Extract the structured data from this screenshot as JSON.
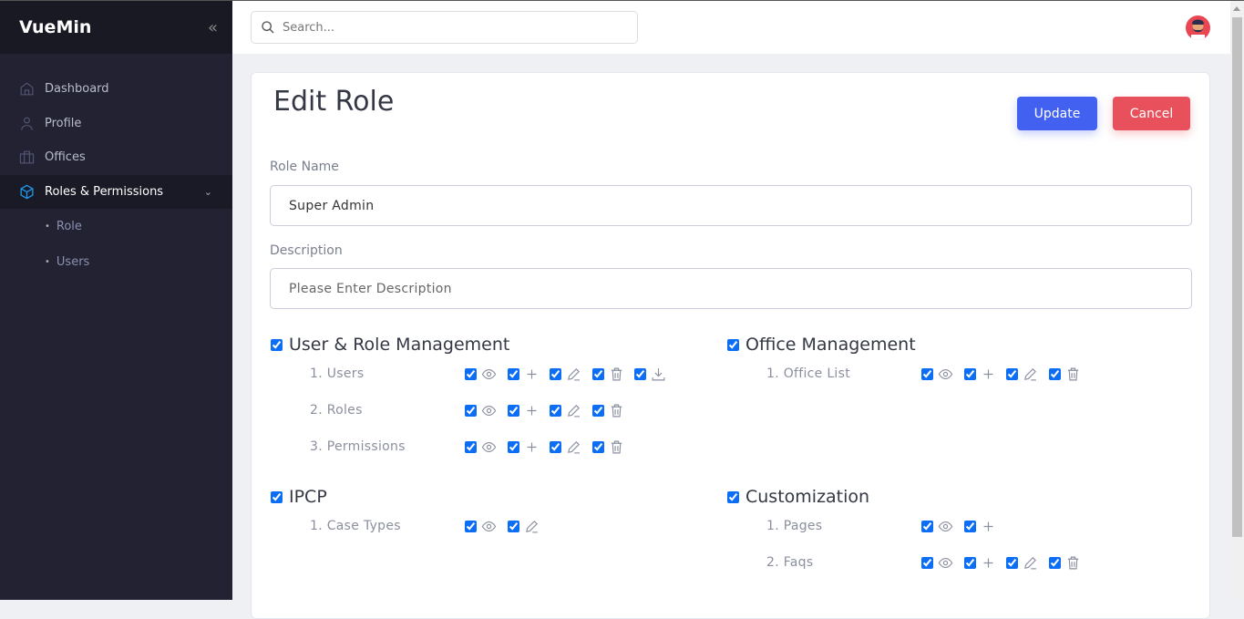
{
  "app": {
    "name": "VueMin"
  },
  "sidebar": {
    "items": [
      {
        "label": "Dashboard",
        "icon": "home-icon"
      },
      {
        "label": "Profile",
        "icon": "user-icon"
      },
      {
        "label": "Offices",
        "icon": "briefcase-icon"
      },
      {
        "label": "Roles & Permissions",
        "icon": "box-icon",
        "active": true
      }
    ],
    "subitems": [
      {
        "label": "Role"
      },
      {
        "label": "Users"
      }
    ]
  },
  "header": {
    "search_placeholder": "Search..."
  },
  "page": {
    "title": "Edit Role",
    "update_label": "Update",
    "cancel_label": "Cancel",
    "role_name_label": "Role Name",
    "role_name_value": "Super Admin",
    "description_label": "Description",
    "description_placeholder": "Please Enter Description"
  },
  "colors": {
    "primary": "#4261f0",
    "danger": "#e8515b",
    "accent": "#1e9bf0",
    "sidebar": "#222232"
  },
  "groups": [
    {
      "title": "User & Role Management",
      "checked": true,
      "items": [
        {
          "name": "1. Users",
          "perms": [
            {
              "icon": "eye",
              "checked": true
            },
            {
              "icon": "plus",
              "checked": true
            },
            {
              "icon": "pencil",
              "checked": true
            },
            {
              "icon": "trash",
              "checked": true
            },
            {
              "icon": "download",
              "checked": true
            }
          ]
        },
        {
          "name": "2. Roles",
          "perms": [
            {
              "icon": "eye",
              "checked": true
            },
            {
              "icon": "plus",
              "checked": true
            },
            {
              "icon": "pencil",
              "checked": true
            },
            {
              "icon": "trash",
              "checked": true
            }
          ]
        },
        {
          "name": "3. Permissions",
          "perms": [
            {
              "icon": "eye",
              "checked": true
            },
            {
              "icon": "plus",
              "checked": true
            },
            {
              "icon": "pencil",
              "checked": true
            },
            {
              "icon": "trash",
              "checked": true
            }
          ]
        }
      ]
    },
    {
      "title": "Office Management",
      "checked": true,
      "items": [
        {
          "name": "1. Office List",
          "perms": [
            {
              "icon": "eye",
              "checked": true
            },
            {
              "icon": "plus",
              "checked": true
            },
            {
              "icon": "pencil",
              "checked": true
            },
            {
              "icon": "trash",
              "checked": true
            }
          ]
        }
      ]
    },
    {
      "title": "IPCP",
      "checked": true,
      "items": [
        {
          "name": "1. Case Types",
          "perms": [
            {
              "icon": "eye",
              "checked": true
            },
            {
              "icon": "pencil",
              "checked": true
            }
          ]
        }
      ]
    },
    {
      "title": "Customization",
      "checked": true,
      "items": [
        {
          "name": "1. Pages",
          "perms": [
            {
              "icon": "eye",
              "checked": true
            },
            {
              "icon": "plus",
              "checked": true
            }
          ]
        },
        {
          "name": "2. Faqs",
          "perms": [
            {
              "icon": "eye",
              "checked": true
            },
            {
              "icon": "plus",
              "checked": true
            },
            {
              "icon": "pencil",
              "checked": true
            },
            {
              "icon": "trash",
              "checked": true
            }
          ]
        }
      ]
    }
  ]
}
